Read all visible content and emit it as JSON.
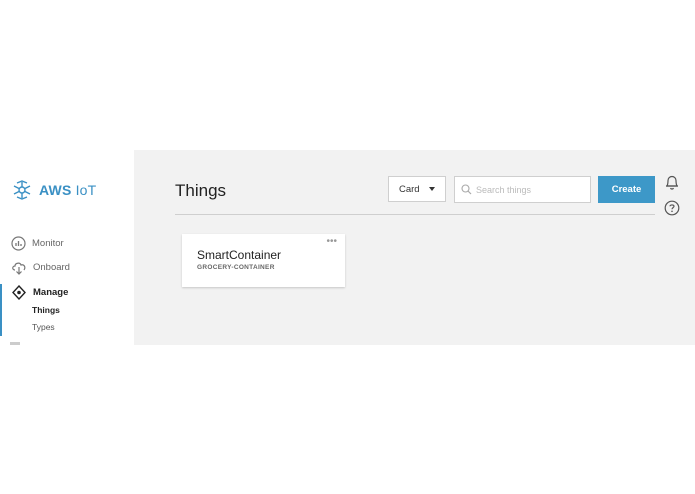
{
  "sidebar": {
    "brand": {
      "name": "AWS",
      "suffix": " IoT"
    },
    "items": [
      {
        "label": "Monitor",
        "icon": "monitor-icon"
      },
      {
        "label": "Onboard",
        "icon": "onboard-icon"
      },
      {
        "label": "Manage",
        "icon": "manage-icon"
      }
    ],
    "subitems": [
      {
        "label": "Things"
      },
      {
        "label": "Types"
      }
    ]
  },
  "main": {
    "title": "Things",
    "view_select": {
      "value": "Card"
    },
    "search": {
      "placeholder": "Search things",
      "value": ""
    },
    "create_label": "Create",
    "cards": [
      {
        "name": "SmartContainer",
        "type": "GROCERY-CONTAINER",
        "menu": "•••"
      }
    ]
  },
  "colors": {
    "accent": "#3d98c8",
    "background": "#f2f2f2"
  }
}
